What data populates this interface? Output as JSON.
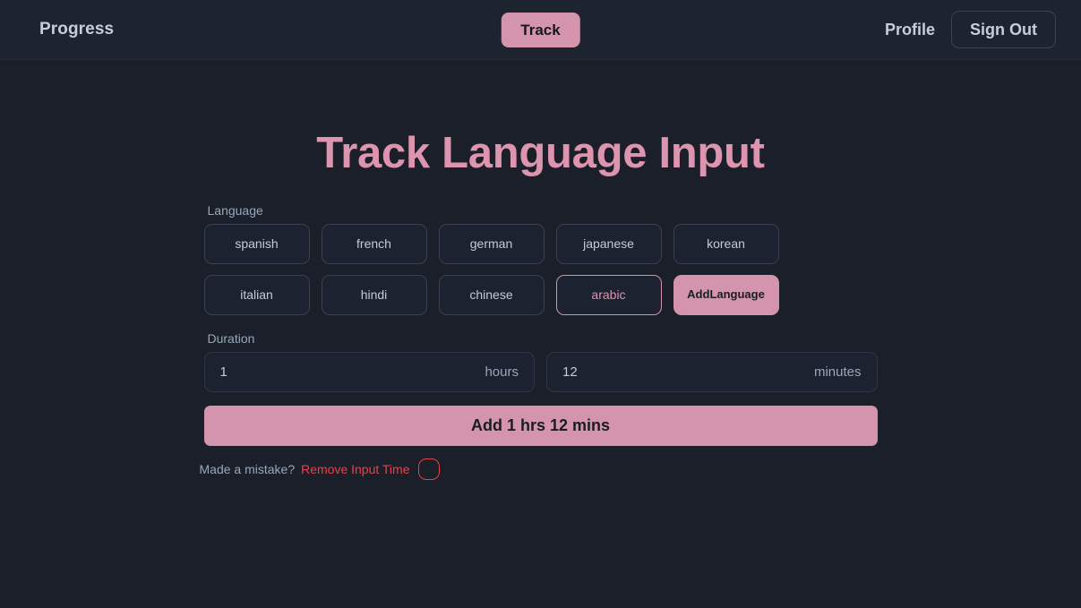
{
  "navbar": {
    "brand": "Progress",
    "track_label": "Track",
    "profile_label": "Profile",
    "signout_label": "Sign Out"
  },
  "main": {
    "title": "Track Language Input",
    "language_label": "Language",
    "languages": [
      {
        "label": "spanish",
        "selected": false
      },
      {
        "label": "french",
        "selected": false
      },
      {
        "label": "german",
        "selected": false
      },
      {
        "label": "japanese",
        "selected": false
      },
      {
        "label": "korean",
        "selected": false
      },
      {
        "label": "italian",
        "selected": false
      },
      {
        "label": "hindi",
        "selected": false
      },
      {
        "label": "chinese",
        "selected": false
      },
      {
        "label": "arabic",
        "selected": true
      }
    ],
    "add_language_line1": "Add",
    "add_language_line2": "Language",
    "duration_label": "Duration",
    "hours_value": "1",
    "hours_suffix": "hours",
    "minutes_value": "12",
    "minutes_suffix": "minutes",
    "submit_label": "Add 1 hrs 12 mins",
    "undo_question": "Made a mistake?",
    "undo_link": "Remove Input Time"
  },
  "colors": {
    "accent_pink": "#d494ab",
    "title_pink": "#dd94ae",
    "danger_red": "#e8414a",
    "page_bg": "#1a1f29",
    "navbar_bg": "#1e242f"
  }
}
